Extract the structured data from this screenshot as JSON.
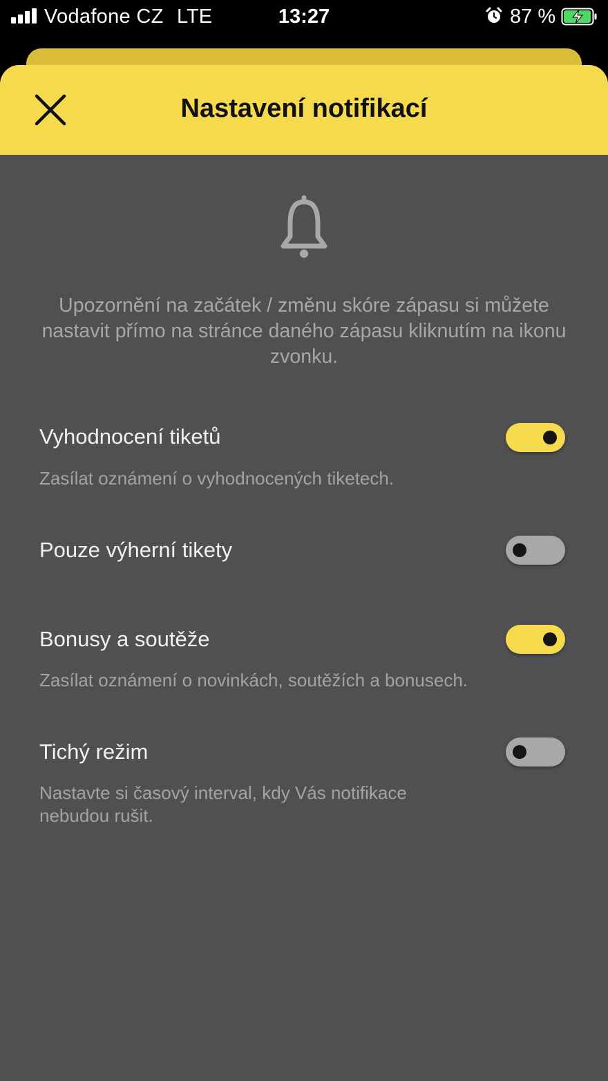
{
  "status_bar": {
    "carrier": "Vodafone CZ",
    "network": "LTE",
    "time": "13:27",
    "battery_percent": "87 %",
    "icons": [
      "signal-icon",
      "alarm-icon",
      "battery-charging-icon"
    ]
  },
  "header": {
    "title": "Nastavení notifikací",
    "close_icon": "close-icon"
  },
  "info": {
    "icon": "bell-icon",
    "text": "Upozornění na začátek / změnu skóre zápasu si můžete nastavit přímo na stránce daného zápasu kliknutím na ikonu zvonku."
  },
  "settings": [
    {
      "title": "Vyhodnocení tiketů",
      "description": "Zasílat oznámení o vyhodnocených tiketech.",
      "enabled": true
    },
    {
      "title": "Pouze výherní tikety",
      "description": "",
      "enabled": false
    },
    {
      "title": "Bonusy a soutěže",
      "description": "Zasílat oznámení o novinkách, soutěžích a bonusech.",
      "enabled": true
    },
    {
      "title": "Tichý režim",
      "description": "Nastavte si časový interval, kdy Vás notifikace nebudou rušit.",
      "enabled": false
    }
  ],
  "colors": {
    "accent": "#f6da4d",
    "background": "#505052",
    "toggle_off": "#a8a8aa"
  }
}
